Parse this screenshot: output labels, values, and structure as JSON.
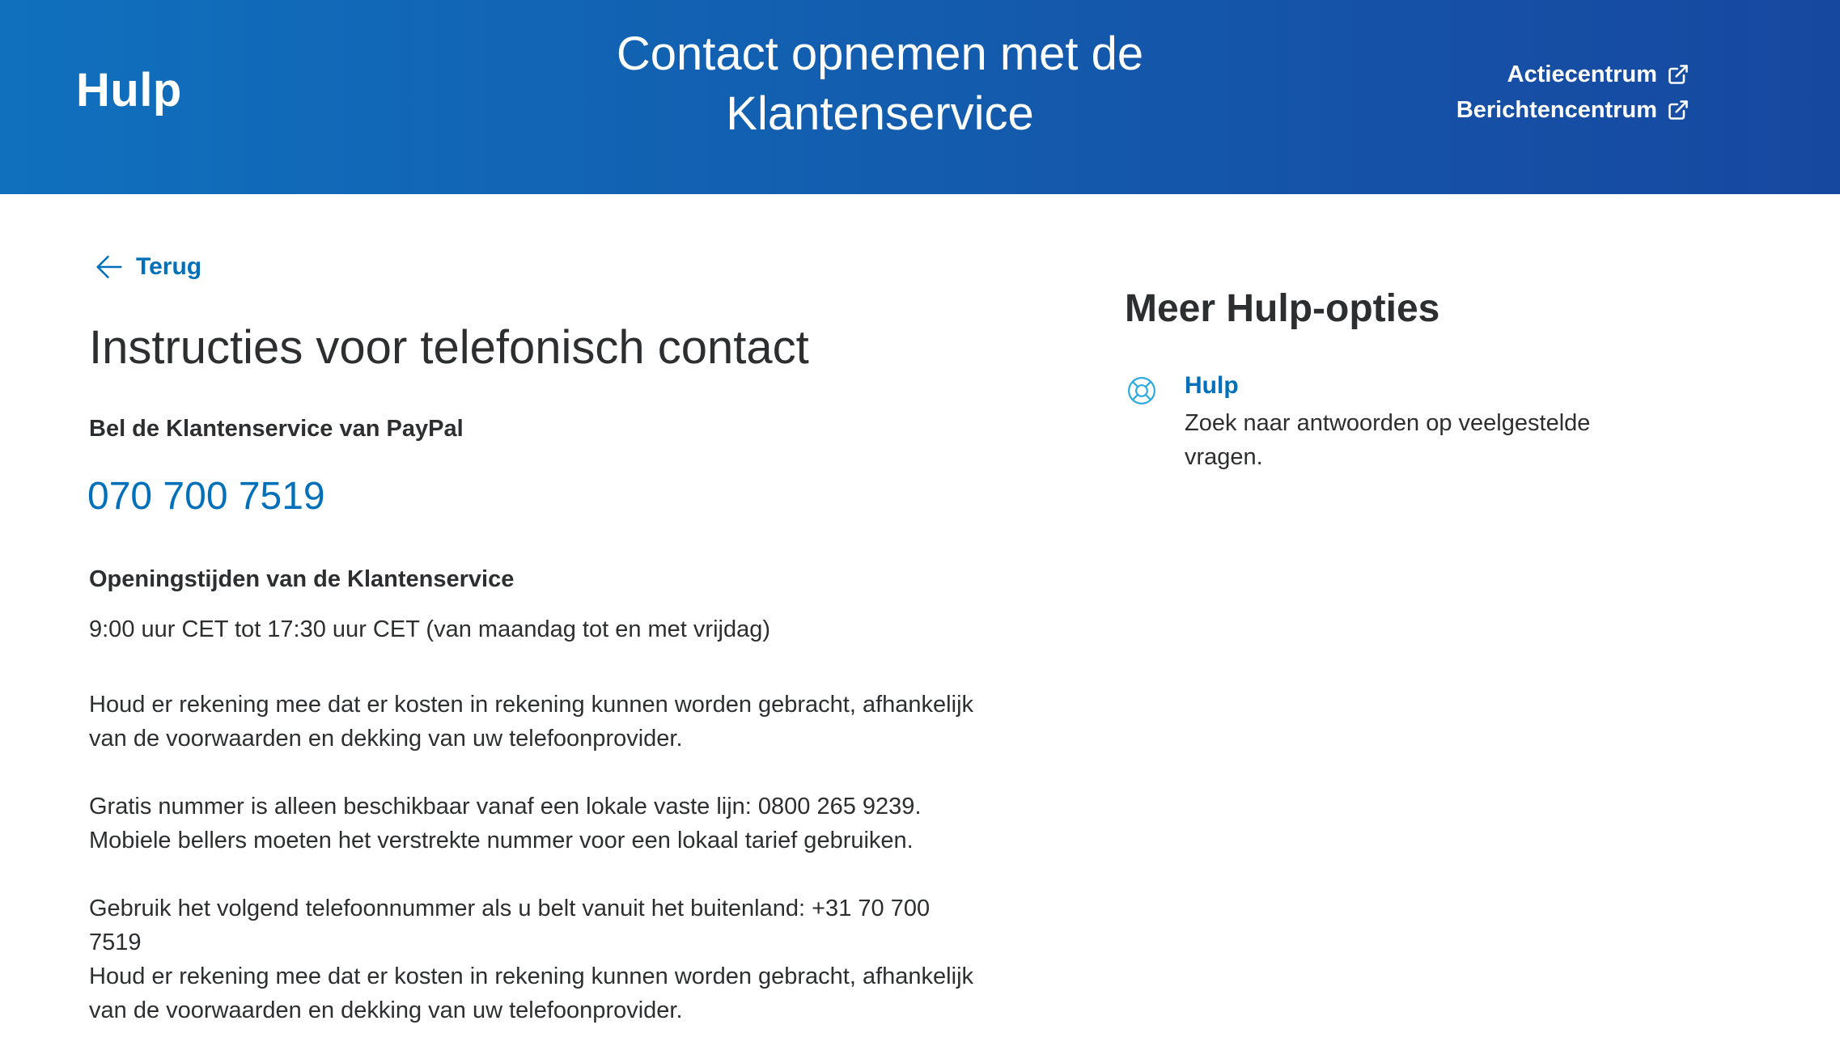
{
  "header": {
    "brand": "Hulp",
    "title": "Contact opnemen met de Klantenservice",
    "links": [
      {
        "label": "Actiecentrum",
        "icon": "external-link-icon"
      },
      {
        "label": "Berichtencentrum",
        "icon": "external-link-icon"
      }
    ]
  },
  "main": {
    "back_label": "Terug",
    "title": "Instructies voor telefonisch contact",
    "call_heading": "Bel de Klantenservice van PayPal",
    "phone": "070 700 7519",
    "hours_heading": "Openingstijden van de Klantenservice",
    "hours": "9:00 uur CET tot 17:30 uur CET (van maandag tot en met vrijdag)",
    "paragraphs": [
      [
        "Houd er rekening mee dat er kosten in rekening kunnen worden gebracht, afhankelijk",
        "van de voorwaarden en dekking van uw telefoonprovider."
      ],
      [
        "Gratis nummer is alleen beschikbaar vanaf een lokale vaste lijn: 0800 265 9239.",
        "Mobiele bellers moeten het verstrekte nummer voor een lokaal tarief gebruiken."
      ],
      [
        "Gebruik het volgend telefoonnummer als u belt vanuit het buitenland: +31 70 700",
        "7519",
        "Houd er rekening mee dat er kosten in rekening kunnen worden gebracht, afhankelijk",
        "van de voorwaarden en dekking van uw telefoonprovider."
      ]
    ]
  },
  "sidebar": {
    "title": "Meer Hulp-opties",
    "options": [
      {
        "title": "Hulp",
        "description": [
          "Zoek naar antwoorden op veelgestelde",
          "vragen."
        ],
        "icon": "lifebuoy-icon"
      }
    ]
  },
  "colors": {
    "header_start": "#1070bd",
    "header_end": "#1748a0",
    "link": "#0070ba",
    "text": "#2c2e2f"
  }
}
